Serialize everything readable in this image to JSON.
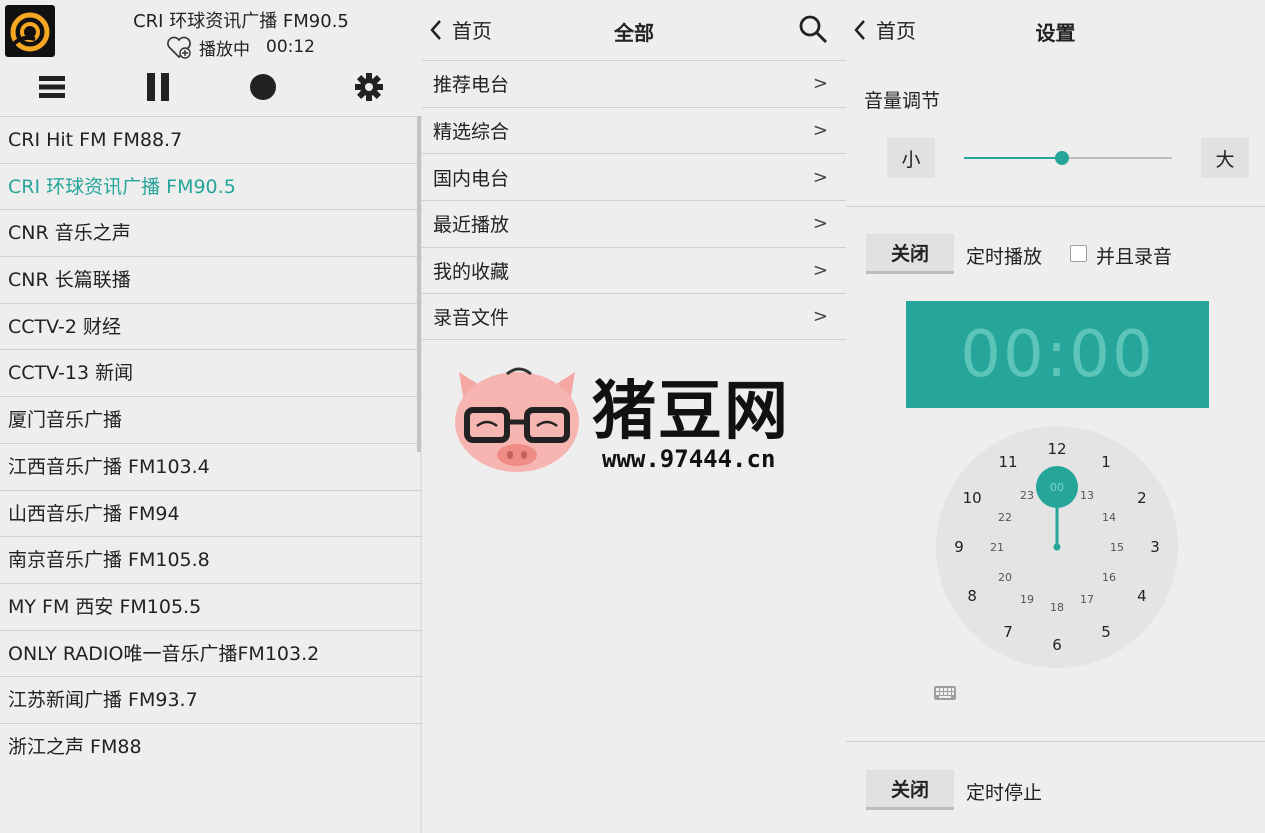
{
  "player": {
    "now_title": "CRI 环球资讯广播 FM90.5",
    "status": "播放中",
    "elapsed": "00:12",
    "controls": [
      "list-icon",
      "pause-icon",
      "record-icon",
      "gear-icon"
    ],
    "stations": [
      {
        "label": "CRI Hit FM FM88.7",
        "active": false
      },
      {
        "label": "CRI 环球资讯广播 FM90.5",
        "active": true
      },
      {
        "label": "CNR 音乐之声",
        "active": false
      },
      {
        "label": "CNR 长篇联播",
        "active": false
      },
      {
        "label": "CCTV-2 财经",
        "active": false
      },
      {
        "label": "CCTV-13 新闻",
        "active": false
      },
      {
        "label": "厦门音乐广播",
        "active": false
      },
      {
        "label": "江西音乐广播 FM103.4",
        "active": false
      },
      {
        "label": "山西音乐广播 FM94",
        "active": false
      },
      {
        "label": "南京音乐广播 FM105.8",
        "active": false
      },
      {
        "label": "MY FM 西安 FM105.5",
        "active": false
      },
      {
        "label": "ONLY RADIO唯一音乐广播FM103.2",
        "active": false
      },
      {
        "label": "江苏新闻广播 FM93.7",
        "active": false
      },
      {
        "label": "浙江之声 FM88",
        "active": false
      }
    ],
    "accent_color": "#26a69a"
  },
  "browse": {
    "back_label": "首页",
    "title": "全部",
    "items": [
      "推荐电台",
      "精选综合",
      "国内电台",
      "最近播放",
      "我的收藏",
      "录音文件"
    ],
    "chevron": ">"
  },
  "watermark": {
    "text": "猪豆网",
    "url": "www.97444.cn"
  },
  "settings": {
    "back_label": "首页",
    "title": "设置",
    "volume_label": "音量调节",
    "vol_low": "小",
    "vol_high": "大",
    "volume_level": 0.47,
    "timer_play": {
      "button": "关闭",
      "label": "定时播放",
      "record_label": "并且录音",
      "record_checked": false
    },
    "time_display": "00:00",
    "timer_stop": {
      "button": "关闭",
      "label": "定时停止"
    },
    "clock": {
      "outer": [
        "12",
        "1",
        "2",
        "3",
        "4",
        "5",
        "6",
        "7",
        "8",
        "9",
        "10",
        "11"
      ],
      "inner": [
        "00",
        "13",
        "14",
        "15",
        "16",
        "17",
        "18",
        "19",
        "20",
        "21",
        "22",
        "23"
      ],
      "selected": "00"
    },
    "accent_color": "#26a69a"
  }
}
